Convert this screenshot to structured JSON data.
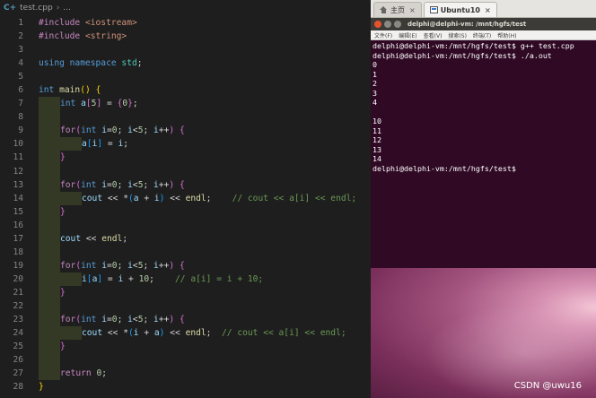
{
  "editor": {
    "breadcrumb": {
      "file": "test.cpp",
      "ellipsis": "..."
    },
    "lines": [
      {
        "n": "1",
        "indent": 0,
        "toks": [
          [
            "inc",
            "#include "
          ],
          [
            "str",
            "<iostream>"
          ]
        ]
      },
      {
        "n": "2",
        "indent": 0,
        "toks": [
          [
            "inc",
            "#include "
          ],
          [
            "str",
            "<string>"
          ]
        ]
      },
      {
        "n": "3",
        "indent": 0,
        "toks": []
      },
      {
        "n": "4",
        "indent": 0,
        "toks": [
          [
            "kw",
            "using "
          ],
          [
            "kw",
            "namespace "
          ],
          [
            "ty",
            "std"
          ],
          [
            "p",
            ";"
          ]
        ]
      },
      {
        "n": "5",
        "indent": 0,
        "toks": []
      },
      {
        "n": "6",
        "indent": 0,
        "toks": [
          [
            "kw",
            "int "
          ],
          [
            "fn",
            "main"
          ],
          [
            "br1",
            "()"
          ],
          [
            "p",
            " "
          ],
          [
            "br1",
            "{"
          ]
        ]
      },
      {
        "n": "7",
        "indent": 1,
        "toks": [
          [
            "kw",
            "int "
          ],
          [
            "var",
            "a"
          ],
          [
            "br2",
            "["
          ],
          [
            "num",
            "5"
          ],
          [
            "br2",
            "]"
          ],
          [
            "p",
            " = "
          ],
          [
            "br2",
            "{"
          ],
          [
            "num",
            "0"
          ],
          [
            "br2",
            "}"
          ],
          [
            "p",
            ";"
          ]
        ]
      },
      {
        "n": "8",
        "indent": 1,
        "toks": []
      },
      {
        "n": "9",
        "indent": 1,
        "toks": [
          [
            "ctl",
            "for"
          ],
          [
            "br2",
            "("
          ],
          [
            "kw",
            "int "
          ],
          [
            "var",
            "i"
          ],
          [
            "p",
            "="
          ],
          [
            "num",
            "0"
          ],
          [
            "p",
            "; "
          ],
          [
            "var",
            "i"
          ],
          [
            "p",
            "<"
          ],
          [
            "num",
            "5"
          ],
          [
            "p",
            "; "
          ],
          [
            "var",
            "i"
          ],
          [
            "p",
            "++"
          ],
          [
            "br2",
            ")"
          ],
          [
            "p",
            " "
          ],
          [
            "br2",
            "{"
          ]
        ]
      },
      {
        "n": "10",
        "indent": 2,
        "toks": [
          [
            "var",
            "a"
          ],
          [
            "br3",
            "["
          ],
          [
            "var",
            "i"
          ],
          [
            "br3",
            "]"
          ],
          [
            "p",
            " = "
          ],
          [
            "var",
            "i"
          ],
          [
            "p",
            ";"
          ]
        ]
      },
      {
        "n": "11",
        "indent": 1,
        "toks": [
          [
            "br2",
            "}"
          ]
        ]
      },
      {
        "n": "12",
        "indent": 1,
        "toks": []
      },
      {
        "n": "13",
        "indent": 1,
        "toks": [
          [
            "ctl",
            "for"
          ],
          [
            "br2",
            "("
          ],
          [
            "kw",
            "int "
          ],
          [
            "var",
            "i"
          ],
          [
            "p",
            "="
          ],
          [
            "num",
            "0"
          ],
          [
            "p",
            "; "
          ],
          [
            "var",
            "i"
          ],
          [
            "p",
            "<"
          ],
          [
            "num",
            "5"
          ],
          [
            "p",
            "; "
          ],
          [
            "var",
            "i"
          ],
          [
            "p",
            "++"
          ],
          [
            "br2",
            ")"
          ],
          [
            "p",
            " "
          ],
          [
            "br2",
            "{"
          ]
        ]
      },
      {
        "n": "14",
        "indent": 2,
        "toks": [
          [
            "var",
            "cout"
          ],
          [
            "p",
            " << *"
          ],
          [
            "br3",
            "("
          ],
          [
            "var",
            "a"
          ],
          [
            "p",
            " + "
          ],
          [
            "var",
            "i"
          ],
          [
            "br3",
            ")"
          ],
          [
            "p",
            " << "
          ],
          [
            "fn",
            "endl"
          ],
          [
            "p",
            ";    "
          ],
          [
            "cm",
            "// cout << a[i] << endl;"
          ]
        ]
      },
      {
        "n": "15",
        "indent": 1,
        "toks": [
          [
            "br2",
            "}"
          ]
        ]
      },
      {
        "n": "16",
        "indent": 1,
        "toks": []
      },
      {
        "n": "17",
        "indent": 1,
        "toks": [
          [
            "var",
            "cout"
          ],
          [
            "p",
            " << "
          ],
          [
            "fn",
            "endl"
          ],
          [
            "p",
            ";"
          ]
        ]
      },
      {
        "n": "18",
        "indent": 1,
        "toks": []
      },
      {
        "n": "19",
        "indent": 1,
        "toks": [
          [
            "ctl",
            "for"
          ],
          [
            "br2",
            "("
          ],
          [
            "kw",
            "int "
          ],
          [
            "var",
            "i"
          ],
          [
            "p",
            "="
          ],
          [
            "num",
            "0"
          ],
          [
            "p",
            "; "
          ],
          [
            "var",
            "i"
          ],
          [
            "p",
            "<"
          ],
          [
            "num",
            "5"
          ],
          [
            "p",
            "; "
          ],
          [
            "var",
            "i"
          ],
          [
            "p",
            "++"
          ],
          [
            "br2",
            ")"
          ],
          [
            "p",
            " "
          ],
          [
            "br2",
            "{"
          ]
        ]
      },
      {
        "n": "20",
        "indent": 2,
        "toks": [
          [
            "var",
            "i"
          ],
          [
            "br3",
            "["
          ],
          [
            "var",
            "a"
          ],
          [
            "br3",
            "]"
          ],
          [
            "p",
            " = "
          ],
          [
            "var",
            "i"
          ],
          [
            "p",
            " + "
          ],
          [
            "num",
            "10"
          ],
          [
            "p",
            ";    "
          ],
          [
            "cm",
            "// a[i] = i + 10;"
          ]
        ]
      },
      {
        "n": "21",
        "indent": 1,
        "toks": [
          [
            "br2",
            "}"
          ]
        ]
      },
      {
        "n": "22",
        "indent": 1,
        "toks": []
      },
      {
        "n": "23",
        "indent": 1,
        "toks": [
          [
            "ctl",
            "for"
          ],
          [
            "br2",
            "("
          ],
          [
            "kw",
            "int "
          ],
          [
            "var",
            "i"
          ],
          [
            "p",
            "="
          ],
          [
            "num",
            "0"
          ],
          [
            "p",
            "; "
          ],
          [
            "var",
            "i"
          ],
          [
            "p",
            "<"
          ],
          [
            "num",
            "5"
          ],
          [
            "p",
            "; "
          ],
          [
            "var",
            "i"
          ],
          [
            "p",
            "++"
          ],
          [
            "br2",
            ")"
          ],
          [
            "p",
            " "
          ],
          [
            "br2",
            "{"
          ]
        ]
      },
      {
        "n": "24",
        "indent": 2,
        "toks": [
          [
            "var",
            "cout"
          ],
          [
            "p",
            " << *"
          ],
          [
            "br3",
            "("
          ],
          [
            "var",
            "i"
          ],
          [
            "p",
            " + "
          ],
          [
            "var",
            "a"
          ],
          [
            "br3",
            ")"
          ],
          [
            "p",
            " << "
          ],
          [
            "fn",
            "endl"
          ],
          [
            "p",
            ";  "
          ],
          [
            "cm",
            "// cout << a[i] << endl;"
          ]
        ]
      },
      {
        "n": "25",
        "indent": 1,
        "toks": [
          [
            "br2",
            "}"
          ]
        ]
      },
      {
        "n": "26",
        "indent": 1,
        "toks": []
      },
      {
        "n": "27",
        "indent": 1,
        "toks": [
          [
            "ctl",
            "return "
          ],
          [
            "num",
            "0"
          ],
          [
            "p",
            ";"
          ]
        ]
      },
      {
        "n": "28",
        "indent": 0,
        "toks": [
          [
            "br1",
            "}"
          ]
        ]
      }
    ]
  },
  "vm": {
    "tabs": [
      {
        "label": "主页",
        "active": false,
        "icon": "home-icon"
      },
      {
        "label": "Ubuntu10",
        "active": true,
        "icon": "vm-icon"
      }
    ],
    "tab_close": "×",
    "terminal_title": "delphi@delphi-vm: /mnt/hgfs/test",
    "menu": [
      "文件(F)",
      "编辑(E)",
      "查看(V)",
      "搜索(S)",
      "终端(T)",
      "帮助(H)"
    ],
    "output": [
      "delphi@delphi-vm:/mnt/hgfs/test$ g++ test.cpp",
      "delphi@delphi-vm:/mnt/hgfs/test$ ./a.out",
      "0",
      "1",
      "2",
      "3",
      "4",
      "",
      "10",
      "11",
      "12",
      "13",
      "14",
      "delphi@delphi-vm:/mnt/hgfs/test$"
    ],
    "watermark": "CSDN @uwu16"
  },
  "colors": {
    "editor_bg": "#1e1e1e",
    "terminal_bg": "#300a24",
    "keyword": "#569cd6",
    "control": "#c586c0",
    "string": "#ce9178",
    "function": "#dcdcaa",
    "variable": "#9cdcfe",
    "number": "#b5cea8",
    "comment": "#6a9955"
  }
}
